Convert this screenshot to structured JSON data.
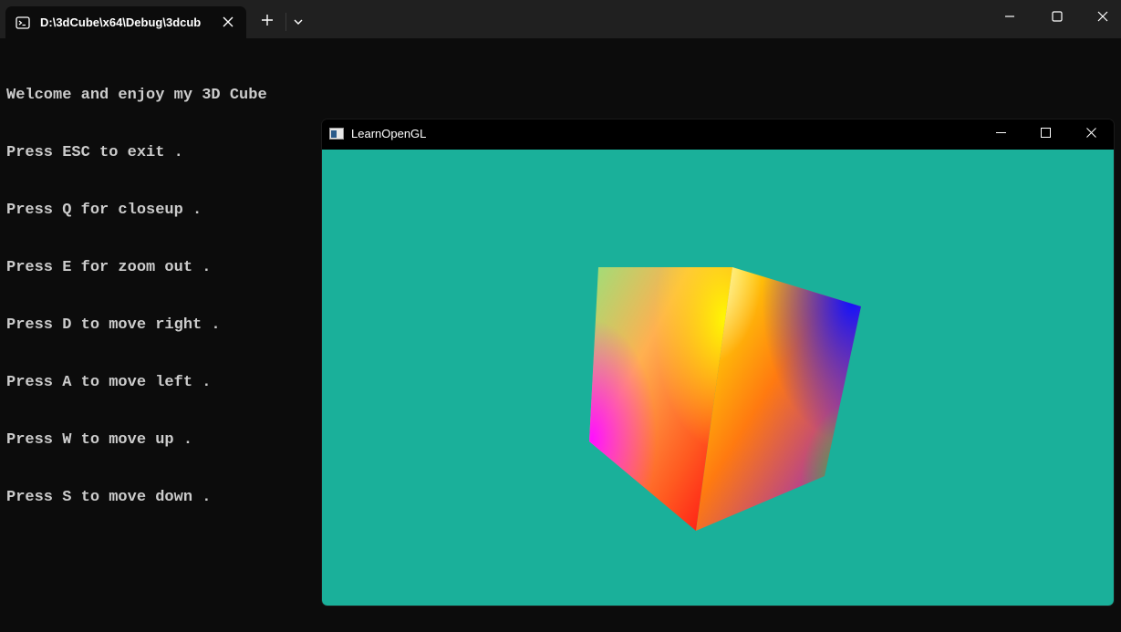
{
  "terminal": {
    "tab_title": "D:\\3dCube\\x64\\Debug\\3dcub",
    "lines": [
      "Welcome and enjoy my 3D Cube",
      "Press ESC to exit .",
      "Press Q for closeup .",
      "Press E for zoom out .",
      "Press D to move right .",
      "Press A to move left .",
      "Press W to move up .",
      "Press S to move down ."
    ],
    "icons": {
      "tab": "terminal-icon",
      "close": "close-icon",
      "new_tab": "plus-icon",
      "dropdown": "chevron-down-icon"
    }
  },
  "gl_window": {
    "title": "LearnOpenGL",
    "background_color": "#1ab09a",
    "icons": {
      "app": "app-window-icon",
      "minimize": "minimize-icon",
      "maximize": "maximize-icon",
      "close": "close-icon"
    }
  },
  "colors": {
    "terminal_bg": "#0c0c0c",
    "titlebar_bg": "#202020",
    "terminal_text": "#cccccc",
    "gl_clear": "#1ab09a"
  }
}
